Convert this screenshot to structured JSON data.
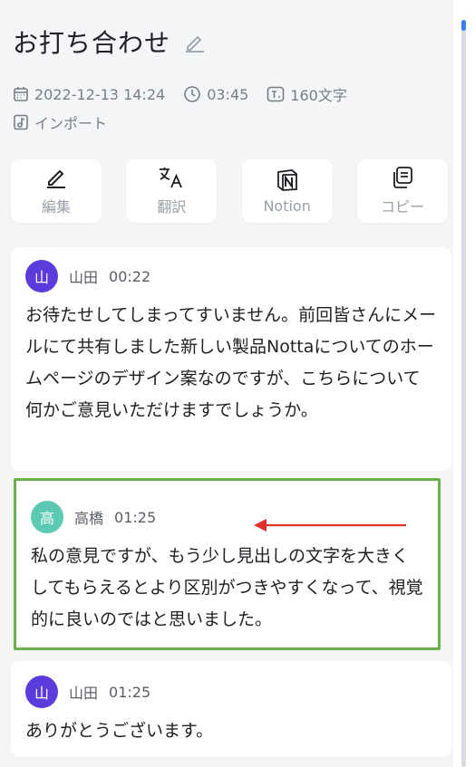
{
  "header": {
    "title": "お打ち合わせ",
    "date": "2022-12-13 14:24",
    "duration": "03:45",
    "char_count": "160文字",
    "source": "インポート"
  },
  "actions": [
    {
      "label": "編集",
      "icon": "pencil-icon"
    },
    {
      "label": "翻訳",
      "icon": "translate-icon"
    },
    {
      "label": "Notion",
      "icon": "notion-icon"
    },
    {
      "label": "コピー",
      "icon": "copy-icon"
    }
  ],
  "transcript": [
    {
      "avatar": "山",
      "speaker": "山田",
      "time": "00:22",
      "color": "#5b3bdc",
      "text": "お待たせしてしまってすいません。前回皆さんにメールにて共有しました新しい製品Nottaについてのホームページのデザイン案なのですが、こちらについて何かご意見いただけますでしょうか。"
    },
    {
      "avatar": "高",
      "speaker": "高橋",
      "time": "01:25",
      "color": "#5ccab2",
      "text": "私の意見ですが、もう少し見出しの文字を大きくしてもらえるとより区別がつきやすくなって、視覚的に良いのではと思いました。"
    },
    {
      "avatar": "山",
      "speaker": "山田",
      "time": "01:25",
      "color": "#5b3bdc",
      "text": "ありがとうございます。"
    }
  ],
  "colors": {
    "highlight_border": "#6cb24c",
    "annotation_arrow": "#e0322b",
    "scroll_accent": "#3a7bf0"
  }
}
